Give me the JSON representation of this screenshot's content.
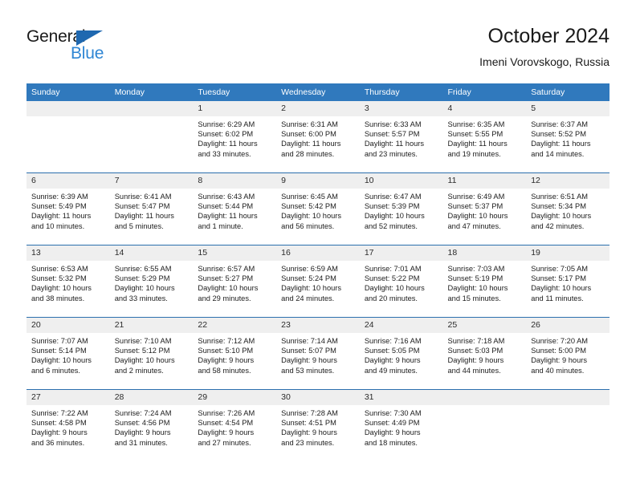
{
  "logo": {
    "word_one": "General",
    "word_two": "Blue",
    "triangle_color": "#1f68b0",
    "blue_color": "#2f86d4"
  },
  "header": {
    "title": "October 2024",
    "subtitle": "Imeni Vorovskogo, Russia"
  },
  "theme": {
    "header_bg": "#3079bd",
    "daynum_bg": "#efefef",
    "row_separator": "#2b6fae",
    "text": "#1c1c1c"
  },
  "weekdays": [
    "Sunday",
    "Monday",
    "Tuesday",
    "Wednesday",
    "Thursday",
    "Friday",
    "Saturday"
  ],
  "labels": {
    "sunrise_prefix": "Sunrise:",
    "sunset_prefix": "Sunset:",
    "daylight_prefix": "Daylight:"
  },
  "weeks": [
    [
      {
        "day": "",
        "sunrise": "",
        "sunset": "",
        "daylight_line1": "",
        "daylight_line2": "",
        "empty": true
      },
      {
        "day": "",
        "sunrise": "",
        "sunset": "",
        "daylight_line1": "",
        "daylight_line2": "",
        "empty": true
      },
      {
        "day": "1",
        "sunrise": "Sunrise: 6:29 AM",
        "sunset": "Sunset: 6:02 PM",
        "daylight_line1": "Daylight: 11 hours",
        "daylight_line2": "and 33 minutes."
      },
      {
        "day": "2",
        "sunrise": "Sunrise: 6:31 AM",
        "sunset": "Sunset: 6:00 PM",
        "daylight_line1": "Daylight: 11 hours",
        "daylight_line2": "and 28 minutes."
      },
      {
        "day": "3",
        "sunrise": "Sunrise: 6:33 AM",
        "sunset": "Sunset: 5:57 PM",
        "daylight_line1": "Daylight: 11 hours",
        "daylight_line2": "and 23 minutes."
      },
      {
        "day": "4",
        "sunrise": "Sunrise: 6:35 AM",
        "sunset": "Sunset: 5:55 PM",
        "daylight_line1": "Daylight: 11 hours",
        "daylight_line2": "and 19 minutes."
      },
      {
        "day": "5",
        "sunrise": "Sunrise: 6:37 AM",
        "sunset": "Sunset: 5:52 PM",
        "daylight_line1": "Daylight: 11 hours",
        "daylight_line2": "and 14 minutes."
      }
    ],
    [
      {
        "day": "6",
        "sunrise": "Sunrise: 6:39 AM",
        "sunset": "Sunset: 5:49 PM",
        "daylight_line1": "Daylight: 11 hours",
        "daylight_line2": "and 10 minutes."
      },
      {
        "day": "7",
        "sunrise": "Sunrise: 6:41 AM",
        "sunset": "Sunset: 5:47 PM",
        "daylight_line1": "Daylight: 11 hours",
        "daylight_line2": "and 5 minutes."
      },
      {
        "day": "8",
        "sunrise": "Sunrise: 6:43 AM",
        "sunset": "Sunset: 5:44 PM",
        "daylight_line1": "Daylight: 11 hours",
        "daylight_line2": "and 1 minute."
      },
      {
        "day": "9",
        "sunrise": "Sunrise: 6:45 AM",
        "sunset": "Sunset: 5:42 PM",
        "daylight_line1": "Daylight: 10 hours",
        "daylight_line2": "and 56 minutes."
      },
      {
        "day": "10",
        "sunrise": "Sunrise: 6:47 AM",
        "sunset": "Sunset: 5:39 PM",
        "daylight_line1": "Daylight: 10 hours",
        "daylight_line2": "and 52 minutes."
      },
      {
        "day": "11",
        "sunrise": "Sunrise: 6:49 AM",
        "sunset": "Sunset: 5:37 PM",
        "daylight_line1": "Daylight: 10 hours",
        "daylight_line2": "and 47 minutes."
      },
      {
        "day": "12",
        "sunrise": "Sunrise: 6:51 AM",
        "sunset": "Sunset: 5:34 PM",
        "daylight_line1": "Daylight: 10 hours",
        "daylight_line2": "and 42 minutes."
      }
    ],
    [
      {
        "day": "13",
        "sunrise": "Sunrise: 6:53 AM",
        "sunset": "Sunset: 5:32 PM",
        "daylight_line1": "Daylight: 10 hours",
        "daylight_line2": "and 38 minutes."
      },
      {
        "day": "14",
        "sunrise": "Sunrise: 6:55 AM",
        "sunset": "Sunset: 5:29 PM",
        "daylight_line1": "Daylight: 10 hours",
        "daylight_line2": "and 33 minutes."
      },
      {
        "day": "15",
        "sunrise": "Sunrise: 6:57 AM",
        "sunset": "Sunset: 5:27 PM",
        "daylight_line1": "Daylight: 10 hours",
        "daylight_line2": "and 29 minutes."
      },
      {
        "day": "16",
        "sunrise": "Sunrise: 6:59 AM",
        "sunset": "Sunset: 5:24 PM",
        "daylight_line1": "Daylight: 10 hours",
        "daylight_line2": "and 24 minutes."
      },
      {
        "day": "17",
        "sunrise": "Sunrise: 7:01 AM",
        "sunset": "Sunset: 5:22 PM",
        "daylight_line1": "Daylight: 10 hours",
        "daylight_line2": "and 20 minutes."
      },
      {
        "day": "18",
        "sunrise": "Sunrise: 7:03 AM",
        "sunset": "Sunset: 5:19 PM",
        "daylight_line1": "Daylight: 10 hours",
        "daylight_line2": "and 15 minutes."
      },
      {
        "day": "19",
        "sunrise": "Sunrise: 7:05 AM",
        "sunset": "Sunset: 5:17 PM",
        "daylight_line1": "Daylight: 10 hours",
        "daylight_line2": "and 11 minutes."
      }
    ],
    [
      {
        "day": "20",
        "sunrise": "Sunrise: 7:07 AM",
        "sunset": "Sunset: 5:14 PM",
        "daylight_line1": "Daylight: 10 hours",
        "daylight_line2": "and 6 minutes."
      },
      {
        "day": "21",
        "sunrise": "Sunrise: 7:10 AM",
        "sunset": "Sunset: 5:12 PM",
        "daylight_line1": "Daylight: 10 hours",
        "daylight_line2": "and 2 minutes."
      },
      {
        "day": "22",
        "sunrise": "Sunrise: 7:12 AM",
        "sunset": "Sunset: 5:10 PM",
        "daylight_line1": "Daylight: 9 hours",
        "daylight_line2": "and 58 minutes."
      },
      {
        "day": "23",
        "sunrise": "Sunrise: 7:14 AM",
        "sunset": "Sunset: 5:07 PM",
        "daylight_line1": "Daylight: 9 hours",
        "daylight_line2": "and 53 minutes."
      },
      {
        "day": "24",
        "sunrise": "Sunrise: 7:16 AM",
        "sunset": "Sunset: 5:05 PM",
        "daylight_line1": "Daylight: 9 hours",
        "daylight_line2": "and 49 minutes."
      },
      {
        "day": "25",
        "sunrise": "Sunrise: 7:18 AM",
        "sunset": "Sunset: 5:03 PM",
        "daylight_line1": "Daylight: 9 hours",
        "daylight_line2": "and 44 minutes."
      },
      {
        "day": "26",
        "sunrise": "Sunrise: 7:20 AM",
        "sunset": "Sunset: 5:00 PM",
        "daylight_line1": "Daylight: 9 hours",
        "daylight_line2": "and 40 minutes."
      }
    ],
    [
      {
        "day": "27",
        "sunrise": "Sunrise: 7:22 AM",
        "sunset": "Sunset: 4:58 PM",
        "daylight_line1": "Daylight: 9 hours",
        "daylight_line2": "and 36 minutes."
      },
      {
        "day": "28",
        "sunrise": "Sunrise: 7:24 AM",
        "sunset": "Sunset: 4:56 PM",
        "daylight_line1": "Daylight: 9 hours",
        "daylight_line2": "and 31 minutes."
      },
      {
        "day": "29",
        "sunrise": "Sunrise: 7:26 AM",
        "sunset": "Sunset: 4:54 PM",
        "daylight_line1": "Daylight: 9 hours",
        "daylight_line2": "and 27 minutes."
      },
      {
        "day": "30",
        "sunrise": "Sunrise: 7:28 AM",
        "sunset": "Sunset: 4:51 PM",
        "daylight_line1": "Daylight: 9 hours",
        "daylight_line2": "and 23 minutes."
      },
      {
        "day": "31",
        "sunrise": "Sunrise: 7:30 AM",
        "sunset": "Sunset: 4:49 PM",
        "daylight_line1": "Daylight: 9 hours",
        "daylight_line2": "and 18 minutes."
      },
      {
        "day": "",
        "sunrise": "",
        "sunset": "",
        "daylight_line1": "",
        "daylight_line2": "",
        "empty": true
      },
      {
        "day": "",
        "sunrise": "",
        "sunset": "",
        "daylight_line1": "",
        "daylight_line2": "",
        "empty": true
      }
    ]
  ]
}
